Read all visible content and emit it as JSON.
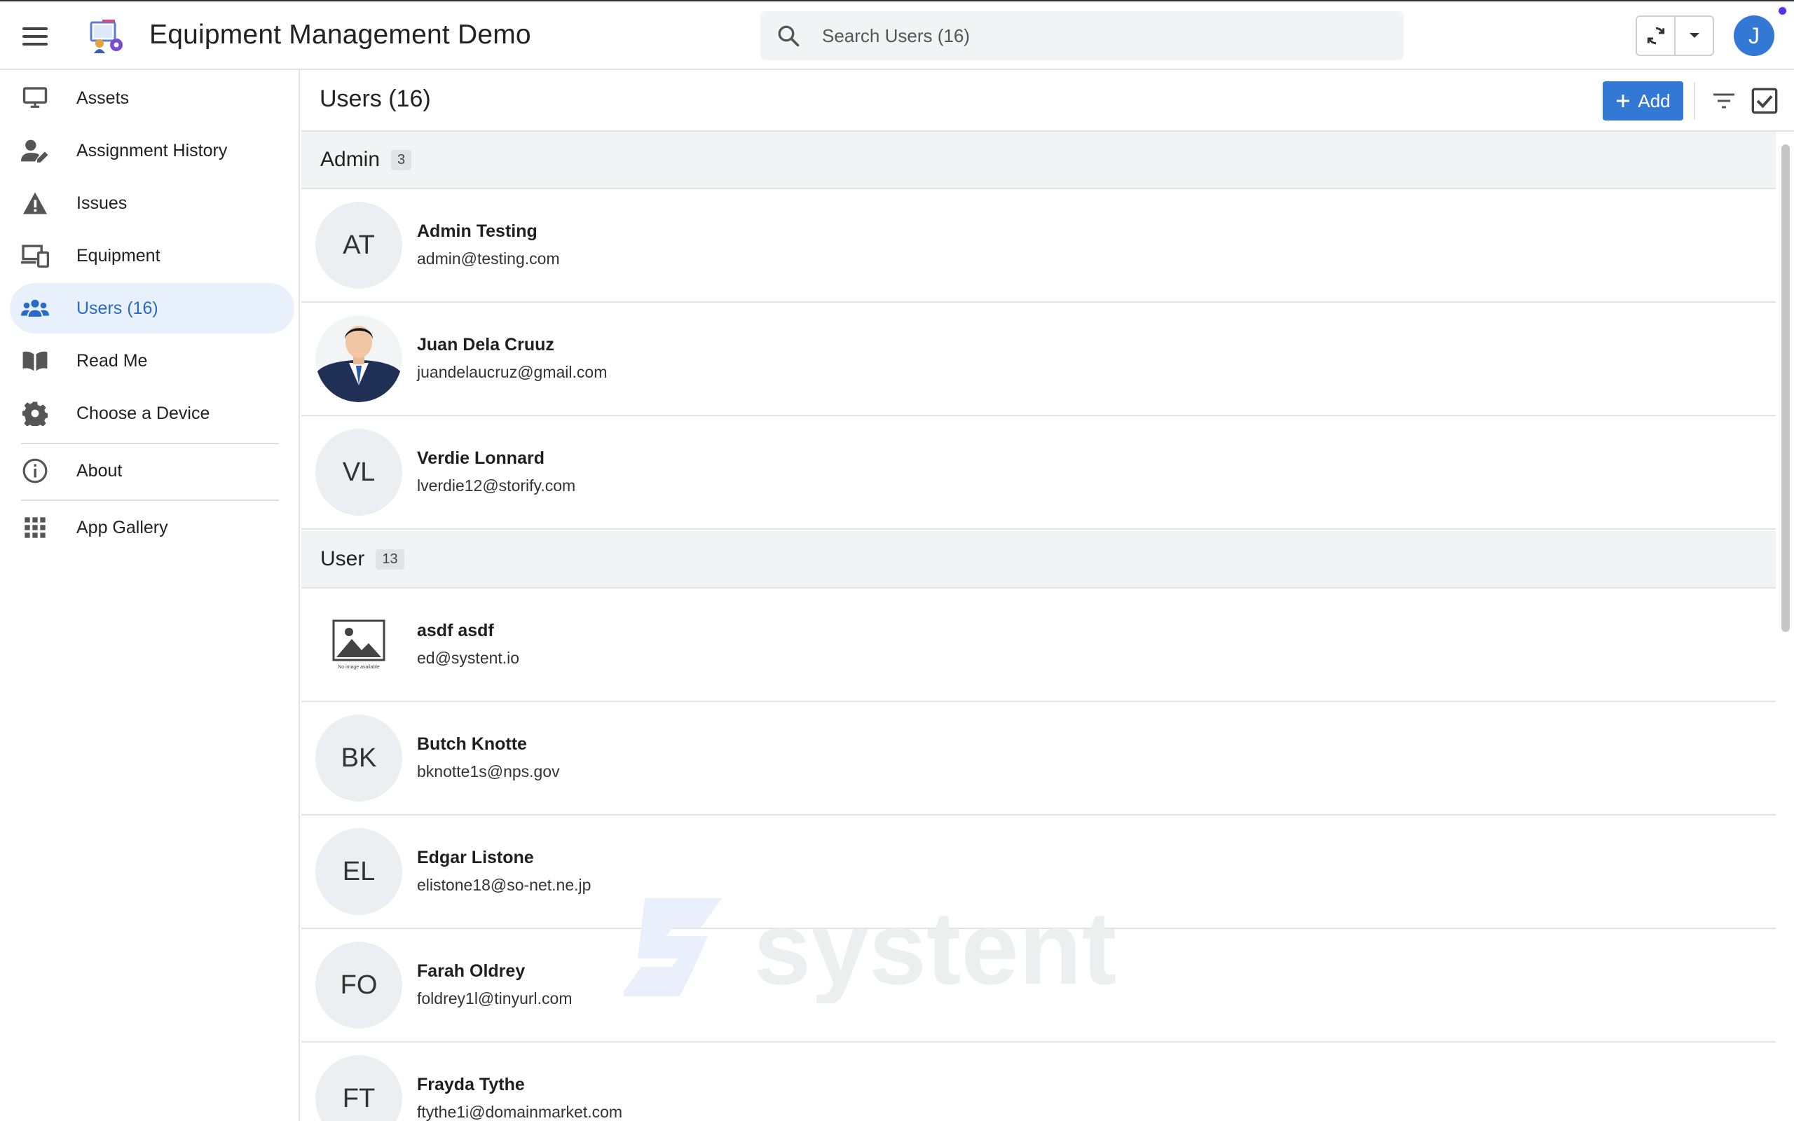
{
  "header": {
    "app_title": "Equipment Management Demo",
    "search_placeholder": "Search Users (16)",
    "user_initial": "J"
  },
  "sidebar": {
    "items": [
      {
        "label": "Assets",
        "icon": "monitor-icon"
      },
      {
        "label": "Assignment History",
        "icon": "user-edit-icon"
      },
      {
        "label": "Issues",
        "icon": "warning-icon"
      },
      {
        "label": "Equipment",
        "icon": "devices-icon"
      },
      {
        "label": "Users (16)",
        "icon": "users-icon",
        "active": true
      },
      {
        "label": "Read Me",
        "icon": "book-icon"
      },
      {
        "label": "Choose a Device",
        "icon": "gear-icon"
      },
      {
        "label": "About",
        "icon": "info-icon"
      },
      {
        "label": "App Gallery",
        "icon": "grid-icon"
      }
    ]
  },
  "main": {
    "title": "Users (16)",
    "add_label": "Add",
    "groups": [
      {
        "label": "Admin",
        "count": "3",
        "users": [
          {
            "initials": "AT",
            "name": "Admin Testing",
            "email": "admin@testing.com",
            "avatar": "initials"
          },
          {
            "initials": "",
            "name": "Juan Dela Cruuz",
            "email": "juandelaucruz@gmail.com",
            "avatar": "photo"
          },
          {
            "initials": "VL",
            "name": "Verdie Lonnard",
            "email": "lverdie12@storify.com",
            "avatar": "initials"
          }
        ]
      },
      {
        "label": "User",
        "count": "13",
        "users": [
          {
            "initials": "",
            "name": "asdf asdf",
            "email": "ed@systent.io",
            "avatar": "no-image",
            "no_image_text": "No image available"
          },
          {
            "initials": "BK",
            "name": "Butch Knotte",
            "email": "bknotte1s@nps.gov",
            "avatar": "initials"
          },
          {
            "initials": "EL",
            "name": "Edgar Listone",
            "email": "elistone18@so-net.ne.jp",
            "avatar": "initials"
          },
          {
            "initials": "FO",
            "name": "Farah Oldrey",
            "email": "foldrey1l@tinyurl.com",
            "avatar": "initials"
          },
          {
            "initials": "FT",
            "name": "Frayda Tythe",
            "email": "ftythe1i@domainmarket.com",
            "avatar": "initials"
          }
        ]
      }
    ]
  },
  "watermark": {
    "text": "systent"
  },
  "colors": {
    "accent": "#3478d6",
    "active_bg": "#e8f0fb",
    "active_text": "#2a6ac8",
    "group_bg": "#f2f3f5"
  }
}
